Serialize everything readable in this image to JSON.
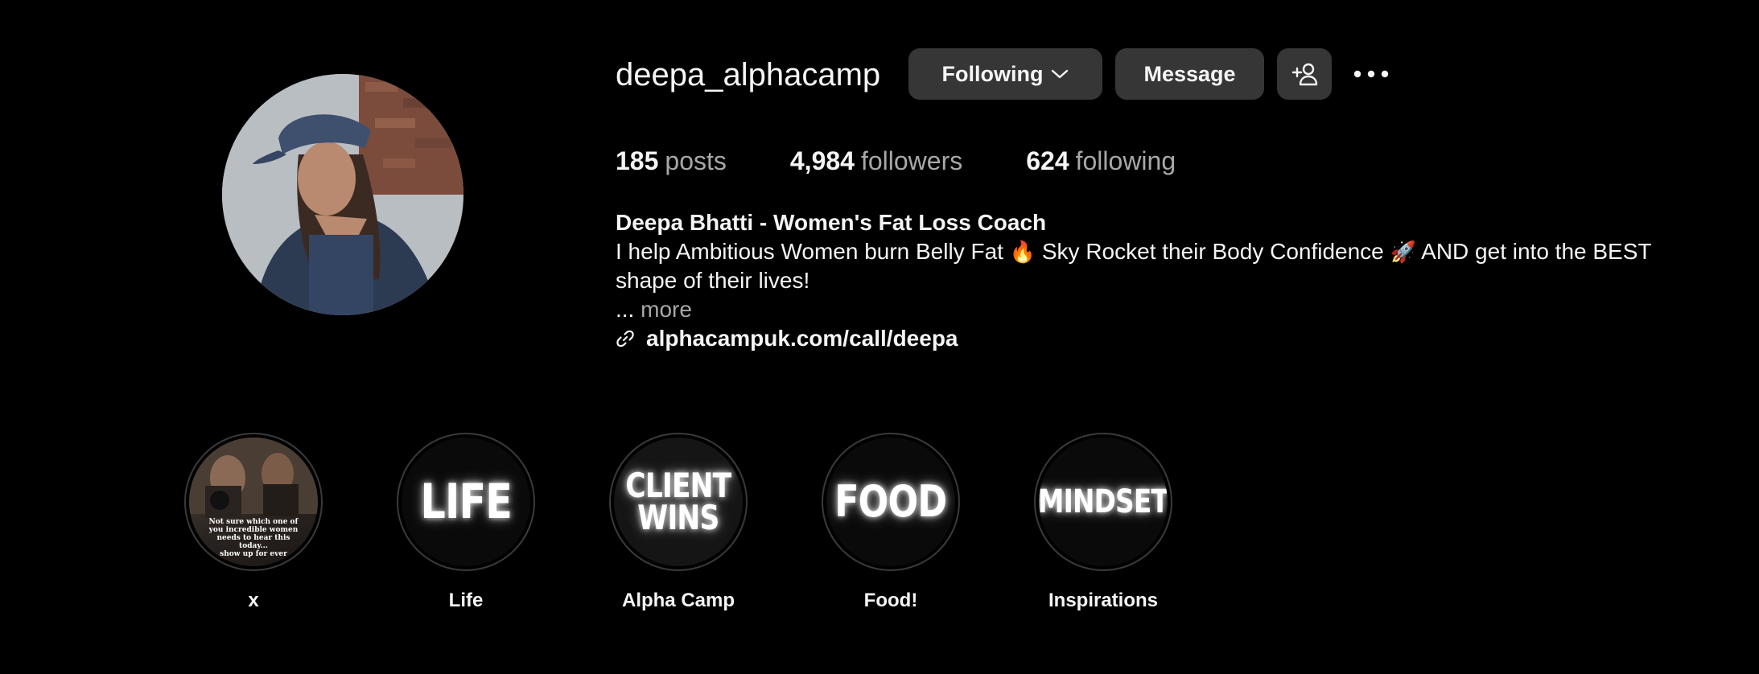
{
  "profile": {
    "username": "deepa_alphacamp",
    "buttons": {
      "following": "Following",
      "message": "Message"
    },
    "stats": [
      {
        "count": "185",
        "label": "posts"
      },
      {
        "count": "4,984",
        "label": "followers"
      },
      {
        "count": "624",
        "label": "following"
      }
    ],
    "bio": {
      "name": "Deepa Bhatti - Women's Fat Loss Coach",
      "text_part1": "I help Ambitious Women burn Belly Fat ",
      "emoji1": "🔥",
      "text_part2": " Sky Rocket their Body Confidence ",
      "emoji2": "🚀",
      "text_part3": " AND get into the BEST shape of their lives!",
      "ellipsis": "... ",
      "more": "more",
      "link": "alphacampuk.com/call/deepa"
    }
  },
  "highlights": [
    {
      "label": "x",
      "cover": "photo",
      "caption": "Not sure which one of you incredible women needs to hear this today...",
      "caption2": "show up for ever"
    },
    {
      "label": "Life",
      "cover_text": "LIFE"
    },
    {
      "label": "Alpha Camp",
      "cover_text_line1": "CLIENT",
      "cover_text_line2": "WINS"
    },
    {
      "label": "Food!",
      "cover_text": "FOOD"
    },
    {
      "label": "Inspirations",
      "cover_text": "MINDSET"
    }
  ],
  "colors": {
    "background": "#000000",
    "button_bg": "#363636",
    "text_primary": "#f5f5f5",
    "text_secondary": "#a8a8a8",
    "highlight_ring": "#3a3a3a"
  },
  "icons": [
    "chevron-down-icon",
    "add-user-icon",
    "more-options-icon",
    "link-icon"
  ]
}
